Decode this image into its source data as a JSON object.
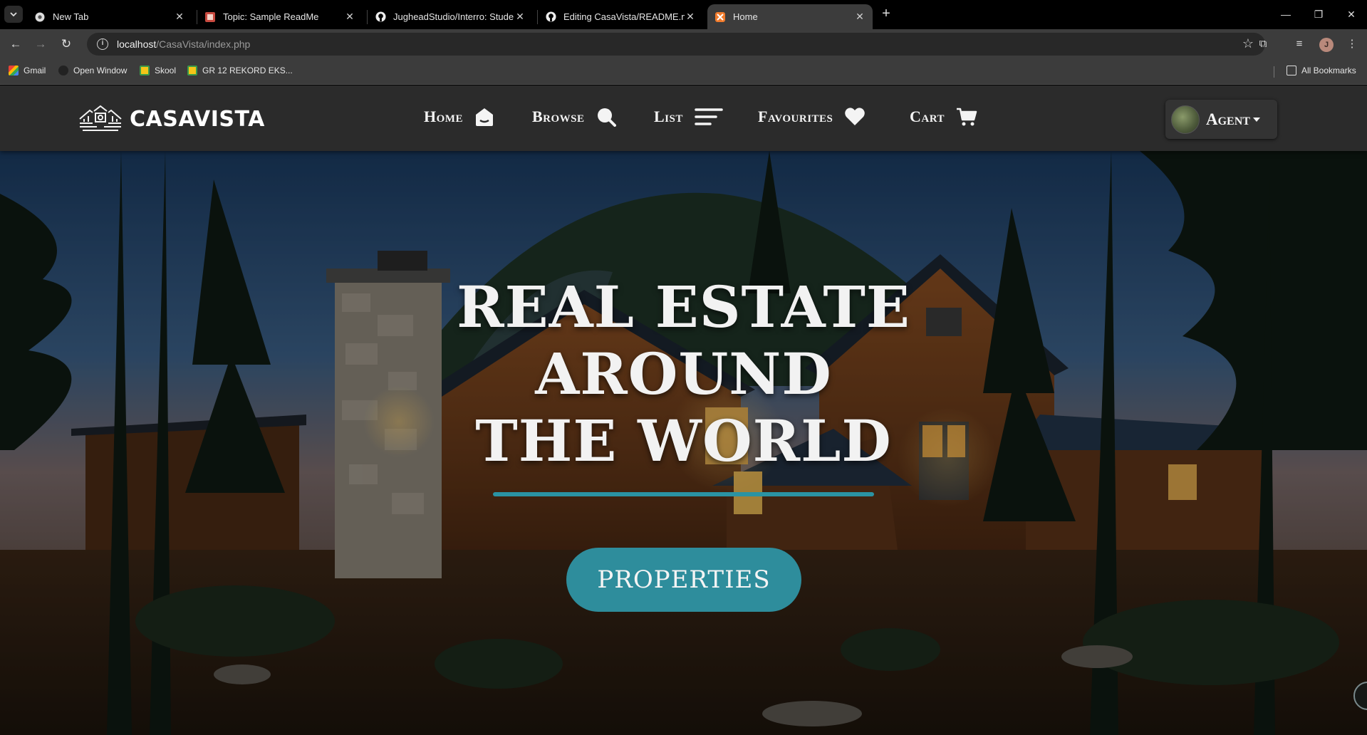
{
  "browser": {
    "tabs": [
      {
        "title": "New Tab",
        "icon": "chrome-icon",
        "active": false
      },
      {
        "title": "Topic: Sample ReadMe",
        "icon": "forum-icon",
        "active": false
      },
      {
        "title": "JugheadStudio/Interro: Student",
        "icon": "github-icon",
        "active": false
      },
      {
        "title": "Editing CasaVista/README.md",
        "icon": "github-icon",
        "active": false
      },
      {
        "title": "Home",
        "icon": "xampp-icon",
        "active": true
      }
    ],
    "address": {
      "host": "localhost",
      "path": "/CasaVista/index.php"
    },
    "profile_initial": "J",
    "bookmarks": [
      {
        "label": "Gmail",
        "icon": "gmail-icon"
      },
      {
        "label": "Open Window",
        "icon": "globe-icon"
      },
      {
        "label": "Skool",
        "icon": "classroom-icon"
      },
      {
        "label": "GR 12 REKORD EKS...",
        "icon": "classroom-icon"
      }
    ],
    "all_bookmarks": "All Bookmarks"
  },
  "site": {
    "logo_text": "CASAVISTA",
    "nav": [
      {
        "label": "Home",
        "icon": "home-icon"
      },
      {
        "label": "Browse",
        "icon": "search-icon"
      },
      {
        "label": "List",
        "icon": "list-icon"
      },
      {
        "label": "Favourites",
        "icon": "heart-icon"
      },
      {
        "label": "Cart",
        "icon": "cart-icon"
      }
    ],
    "account": {
      "label": "Agent"
    }
  },
  "hero": {
    "title_lines": [
      "REAL ESTATE",
      "AROUND",
      "THE WORLD"
    ],
    "cta": "PROPERTIES"
  },
  "colors": {
    "accent": "#2e8d9c",
    "underline": "#2a93a3",
    "header_bg": "#2b2b2b"
  }
}
